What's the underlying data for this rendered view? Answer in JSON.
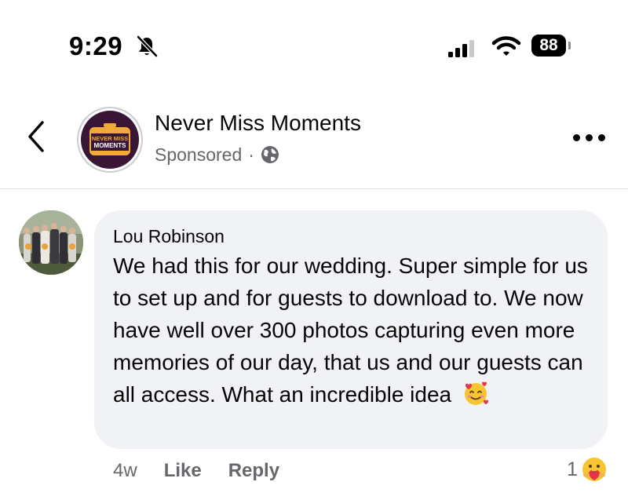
{
  "status_bar": {
    "time": "9:29",
    "battery_level": "88",
    "icons": [
      "bell-muted-icon",
      "cellular-signal-icon",
      "wifi-icon",
      "battery-icon"
    ]
  },
  "post_header": {
    "back_icon": "chevron-left-icon",
    "page_name": "Never Miss Moments",
    "sponsored_label": "Sponsored",
    "separator": "·",
    "audience_icon": "globe-icon",
    "more_icon": "more-horizontal-icon",
    "logo_text_top": "NEVER MISS",
    "logo_text_bottom": "MOMENTS"
  },
  "comment": {
    "author": "Lou Robinson",
    "text": "We had this for our wedding. Super simple for us to set up and for guests to download to. We now have well over 300 photos capturing even more memories of our day, that us and our guests can all access. What an incredible idea",
    "emoji": "smiling-face-with-hearts",
    "time_ago": "4w",
    "like_label": "Like",
    "reply_label": "Reply",
    "reaction_count": "1",
    "reaction_type": "care"
  },
  "colors": {
    "bubble_bg": "#f0f2f5",
    "secondary_text": "#65676b",
    "primary_text": "#050505",
    "logo_bg": "#3a1636",
    "logo_accent": "#f2a93b"
  }
}
